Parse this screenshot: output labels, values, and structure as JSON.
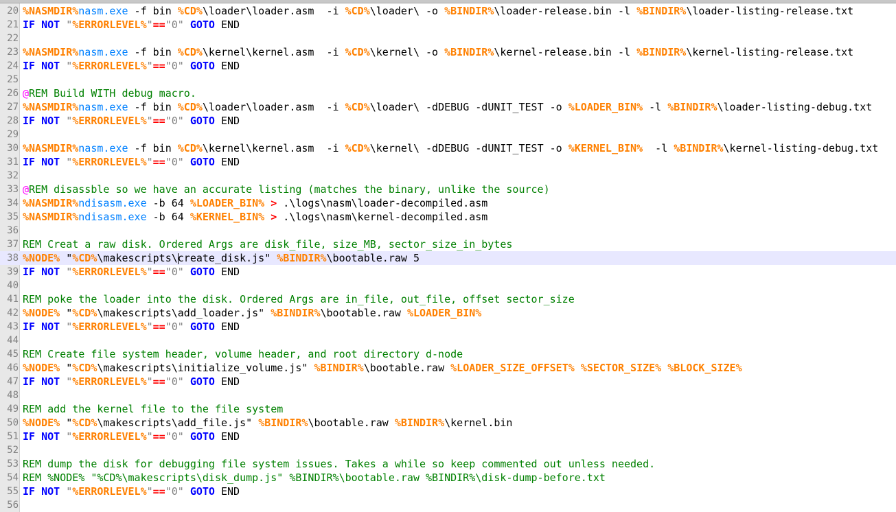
{
  "editor": {
    "lines": [
      {
        "n": "20",
        "parts": [
          [
            "var",
            "%NASMDIR%"
          ],
          [
            "cmd",
            "nasm.exe"
          ],
          [
            "txt",
            " -f bin "
          ],
          [
            "var",
            "%CD%"
          ],
          [
            "txt",
            "\\loader\\loader.asm  -i "
          ],
          [
            "var",
            "%CD%"
          ],
          [
            "txt",
            "\\loader\\ -o "
          ],
          [
            "var",
            "%BINDIR%"
          ],
          [
            "txt",
            "\\loader-release.bin -l "
          ],
          [
            "var",
            "%BINDIR%"
          ],
          [
            "txt",
            "\\loader-listing-release.txt"
          ]
        ]
      },
      {
        "n": "21",
        "parts": [
          [
            "kw",
            "IF NOT"
          ],
          [
            "txt",
            " "
          ],
          [
            "str",
            "\""
          ],
          [
            "var",
            "%ERRORLEVEL%"
          ],
          [
            "str",
            "\""
          ],
          [
            "op",
            "=="
          ],
          [
            "str",
            "\"0\""
          ],
          [
            "txt",
            " "
          ],
          [
            "kw",
            "GOTO"
          ],
          [
            "txt",
            " END"
          ]
        ]
      },
      {
        "n": "22",
        "parts": []
      },
      {
        "n": "23",
        "parts": [
          [
            "var",
            "%NASMDIR%"
          ],
          [
            "cmd",
            "nasm.exe"
          ],
          [
            "txt",
            " -f bin "
          ],
          [
            "var",
            "%CD%"
          ],
          [
            "txt",
            "\\kernel\\kernel.asm  -i "
          ],
          [
            "var",
            "%CD%"
          ],
          [
            "txt",
            "\\kernel\\ -o "
          ],
          [
            "var",
            "%BINDIR%"
          ],
          [
            "txt",
            "\\kernel-release.bin -l "
          ],
          [
            "var",
            "%BINDIR%"
          ],
          [
            "txt",
            "\\kernel-listing-release.txt"
          ]
        ]
      },
      {
        "n": "24",
        "parts": [
          [
            "kw",
            "IF NOT"
          ],
          [
            "txt",
            " "
          ],
          [
            "str",
            "\""
          ],
          [
            "var",
            "%ERRORLEVEL%"
          ],
          [
            "str",
            "\""
          ],
          [
            "op",
            "=="
          ],
          [
            "str",
            "\"0\""
          ],
          [
            "txt",
            " "
          ],
          [
            "kw",
            "GOTO"
          ],
          [
            "txt",
            " END"
          ]
        ]
      },
      {
        "n": "25",
        "parts": []
      },
      {
        "n": "26",
        "parts": [
          [
            "label",
            "@"
          ],
          [
            "cmt",
            "REM Build WITH debug macro."
          ]
        ]
      },
      {
        "n": "27",
        "parts": [
          [
            "var",
            "%NASMDIR%"
          ],
          [
            "cmd",
            "nasm.exe"
          ],
          [
            "txt",
            " -f bin "
          ],
          [
            "var",
            "%CD%"
          ],
          [
            "txt",
            "\\loader\\loader.asm  -i "
          ],
          [
            "var",
            "%CD%"
          ],
          [
            "txt",
            "\\loader\\ -dDEBUG -dUNIT_TEST -o "
          ],
          [
            "var",
            "%LOADER_BIN%"
          ],
          [
            "txt",
            " -l "
          ],
          [
            "var",
            "%BINDIR%"
          ],
          [
            "txt",
            "\\loader-listing-debug.txt"
          ]
        ]
      },
      {
        "n": "28",
        "parts": [
          [
            "kw",
            "IF NOT"
          ],
          [
            "txt",
            " "
          ],
          [
            "str",
            "\""
          ],
          [
            "var",
            "%ERRORLEVEL%"
          ],
          [
            "str",
            "\""
          ],
          [
            "op",
            "=="
          ],
          [
            "str",
            "\"0\""
          ],
          [
            "txt",
            " "
          ],
          [
            "kw",
            "GOTO"
          ],
          [
            "txt",
            " END"
          ]
        ]
      },
      {
        "n": "29",
        "parts": []
      },
      {
        "n": "30",
        "parts": [
          [
            "var",
            "%NASMDIR%"
          ],
          [
            "cmd",
            "nasm.exe"
          ],
          [
            "txt",
            " -f bin "
          ],
          [
            "var",
            "%CD%"
          ],
          [
            "txt",
            "\\kernel\\kernel.asm  -i "
          ],
          [
            "var",
            "%CD%"
          ],
          [
            "txt",
            "\\kernel\\ -dDEBUG -dUNIT_TEST -o "
          ],
          [
            "var",
            "%KERNEL_BIN%"
          ],
          [
            "txt",
            "  -l "
          ],
          [
            "var",
            "%BINDIR%"
          ],
          [
            "txt",
            "\\kernel-listing-debug.txt"
          ]
        ]
      },
      {
        "n": "31",
        "parts": [
          [
            "kw",
            "IF NOT"
          ],
          [
            "txt",
            " "
          ],
          [
            "str",
            "\""
          ],
          [
            "var",
            "%ERRORLEVEL%"
          ],
          [
            "str",
            "\""
          ],
          [
            "op",
            "=="
          ],
          [
            "str",
            "\"0\""
          ],
          [
            "txt",
            " "
          ],
          [
            "kw",
            "GOTO"
          ],
          [
            "txt",
            " END"
          ]
        ]
      },
      {
        "n": "32",
        "parts": []
      },
      {
        "n": "33",
        "parts": [
          [
            "label",
            "@"
          ],
          [
            "cmt",
            "REM disassble so we have an accurate listing (matches the binary, unlike the source)"
          ]
        ]
      },
      {
        "n": "34",
        "parts": [
          [
            "var",
            "%NASMDIR%"
          ],
          [
            "cmd",
            "ndisasm.exe"
          ],
          [
            "txt",
            " -b 64 "
          ],
          [
            "var",
            "%LOADER_BIN%"
          ],
          [
            "txt",
            " "
          ],
          [
            "op",
            ">"
          ],
          [
            "txt",
            " .\\logs\\nasm\\loader-decompiled.asm"
          ]
        ]
      },
      {
        "n": "35",
        "parts": [
          [
            "var",
            "%NASMDIR%"
          ],
          [
            "cmd",
            "ndisasm.exe"
          ],
          [
            "txt",
            " -b 64 "
          ],
          [
            "var",
            "%KERNEL_BIN%"
          ],
          [
            "txt",
            " "
          ],
          [
            "op",
            ">"
          ],
          [
            "txt",
            " .\\logs\\nasm\\kernel-decompiled.asm"
          ]
        ]
      },
      {
        "n": "36",
        "parts": []
      },
      {
        "n": "37",
        "parts": [
          [
            "cmt",
            "REM Creat a raw disk. Ordered Args are disk_file, size_MB, sector_size_in_bytes"
          ]
        ]
      },
      {
        "n": "38",
        "current": true,
        "parts": [
          [
            "var",
            "%NODE%"
          ],
          [
            "txt",
            " \""
          ],
          [
            "var",
            "%CD%"
          ],
          [
            "txt",
            "\\makescripts\\"
          ],
          [
            "caret",
            ""
          ],
          [
            "txt",
            "create_disk.js\" "
          ],
          [
            "var",
            "%BINDIR%"
          ],
          [
            "txt",
            "\\bootable.raw 5"
          ]
        ]
      },
      {
        "n": "39",
        "parts": [
          [
            "kw",
            "IF NOT"
          ],
          [
            "txt",
            " "
          ],
          [
            "str",
            "\""
          ],
          [
            "var",
            "%ERRORLEVEL%"
          ],
          [
            "str",
            "\""
          ],
          [
            "op",
            "=="
          ],
          [
            "str",
            "\"0\""
          ],
          [
            "txt",
            " "
          ],
          [
            "kw",
            "GOTO"
          ],
          [
            "txt",
            " END"
          ]
        ]
      },
      {
        "n": "40",
        "parts": []
      },
      {
        "n": "41",
        "parts": [
          [
            "cmt",
            "REM poke the loader into the disk. Ordered Args are in_file, out_file, offset sector_size"
          ]
        ]
      },
      {
        "n": "42",
        "parts": [
          [
            "var",
            "%NODE%"
          ],
          [
            "txt",
            " \""
          ],
          [
            "var",
            "%CD%"
          ],
          [
            "txt",
            "\\makescripts\\add_loader.js\" "
          ],
          [
            "var",
            "%BINDIR%"
          ],
          [
            "txt",
            "\\bootable.raw "
          ],
          [
            "var",
            "%LOADER_BIN%"
          ]
        ]
      },
      {
        "n": "43",
        "parts": [
          [
            "kw",
            "IF NOT"
          ],
          [
            "txt",
            " "
          ],
          [
            "str",
            "\""
          ],
          [
            "var",
            "%ERRORLEVEL%"
          ],
          [
            "str",
            "\""
          ],
          [
            "op",
            "=="
          ],
          [
            "str",
            "\"0\""
          ],
          [
            "txt",
            " "
          ],
          [
            "kw",
            "GOTO"
          ],
          [
            "txt",
            " END"
          ]
        ]
      },
      {
        "n": "44",
        "parts": []
      },
      {
        "n": "45",
        "parts": [
          [
            "cmt",
            "REM Create file system header, volume header, and root directory d-node"
          ]
        ]
      },
      {
        "n": "46",
        "parts": [
          [
            "var",
            "%NODE%"
          ],
          [
            "txt",
            " \""
          ],
          [
            "var",
            "%CD%"
          ],
          [
            "txt",
            "\\makescripts\\initialize_volume.js\" "
          ],
          [
            "var",
            "%BINDIR%"
          ],
          [
            "txt",
            "\\bootable.raw "
          ],
          [
            "var",
            "%LOADER_SIZE_OFFSET%"
          ],
          [
            "txt",
            " "
          ],
          [
            "var",
            "%SECTOR_SIZE%"
          ],
          [
            "txt",
            " "
          ],
          [
            "var",
            "%BLOCK_SIZE%"
          ]
        ]
      },
      {
        "n": "47",
        "parts": [
          [
            "kw",
            "IF NOT"
          ],
          [
            "txt",
            " "
          ],
          [
            "str",
            "\""
          ],
          [
            "var",
            "%ERRORLEVEL%"
          ],
          [
            "str",
            "\""
          ],
          [
            "op",
            "=="
          ],
          [
            "str",
            "\"0\""
          ],
          [
            "txt",
            " "
          ],
          [
            "kw",
            "GOTO"
          ],
          [
            "txt",
            " END"
          ]
        ]
      },
      {
        "n": "48",
        "parts": []
      },
      {
        "n": "49",
        "parts": [
          [
            "cmt",
            "REM add the kernel file to the file system"
          ]
        ]
      },
      {
        "n": "50",
        "parts": [
          [
            "var",
            "%NODE%"
          ],
          [
            "txt",
            " \""
          ],
          [
            "var",
            "%CD%"
          ],
          [
            "txt",
            "\\makescripts\\add_file.js\" "
          ],
          [
            "var",
            "%BINDIR%"
          ],
          [
            "txt",
            "\\bootable.raw "
          ],
          [
            "var",
            "%BINDIR%"
          ],
          [
            "txt",
            "\\kernel.bin"
          ]
        ]
      },
      {
        "n": "51",
        "parts": [
          [
            "kw",
            "IF NOT"
          ],
          [
            "txt",
            " "
          ],
          [
            "str",
            "\""
          ],
          [
            "var",
            "%ERRORLEVEL%"
          ],
          [
            "str",
            "\""
          ],
          [
            "op",
            "=="
          ],
          [
            "str",
            "\"0\""
          ],
          [
            "txt",
            " "
          ],
          [
            "kw",
            "GOTO"
          ],
          [
            "txt",
            " END"
          ]
        ]
      },
      {
        "n": "52",
        "parts": []
      },
      {
        "n": "53",
        "parts": [
          [
            "cmt",
            "REM dump the disk for debugging file system issues. Takes a while so keep commented out unless needed."
          ]
        ]
      },
      {
        "n": "54",
        "parts": [
          [
            "cmt",
            "REM %NODE% \"%CD%\\makescripts\\disk_dump.js\" %BINDIR%\\bootable.raw %BINDIR%\\disk-dump-before.txt"
          ]
        ]
      },
      {
        "n": "55",
        "parts": [
          [
            "kw",
            "IF NOT"
          ],
          [
            "txt",
            " "
          ],
          [
            "str",
            "\""
          ],
          [
            "var",
            "%ERRORLEVEL%"
          ],
          [
            "str",
            "\""
          ],
          [
            "op",
            "=="
          ],
          [
            "str",
            "\"0\""
          ],
          [
            "txt",
            " "
          ],
          [
            "kw",
            "GOTO"
          ],
          [
            "txt",
            " END"
          ]
        ]
      },
      {
        "n": "56",
        "parts": []
      }
    ]
  }
}
